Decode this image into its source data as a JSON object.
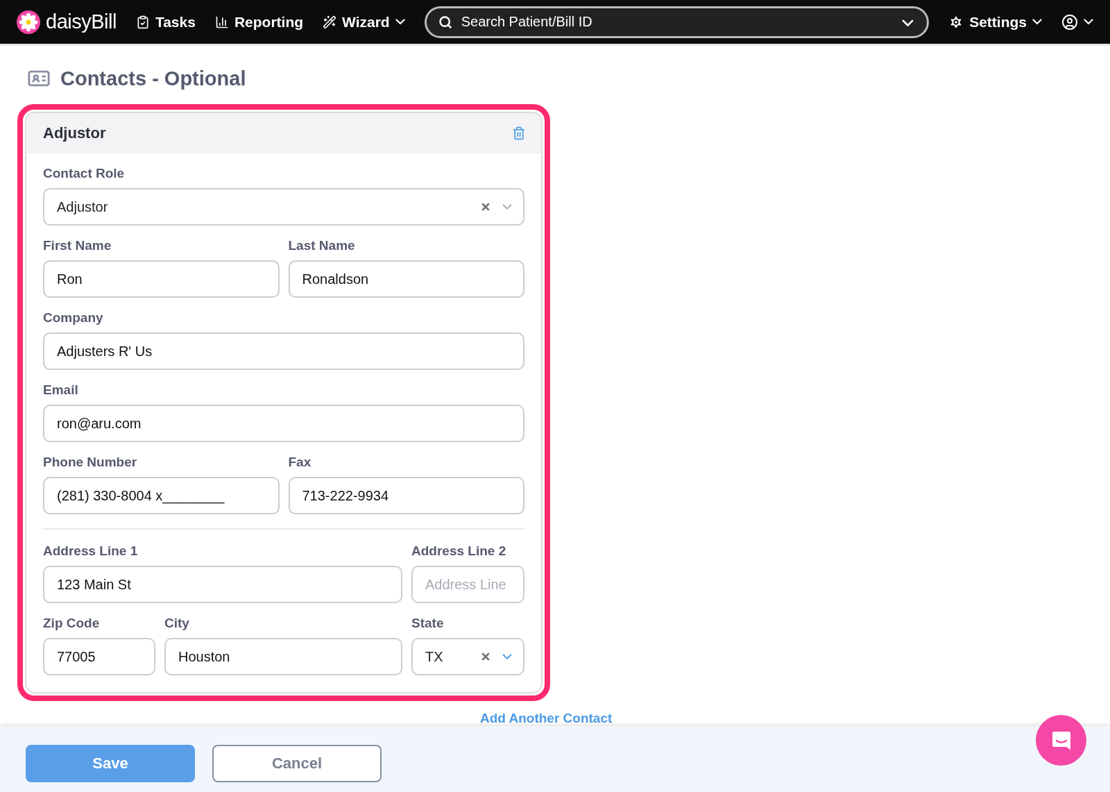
{
  "nav": {
    "logo": "daisyBill",
    "items": [
      {
        "kind": "tasks",
        "label": "Tasks",
        "dropdown": false
      },
      {
        "kind": "reporting",
        "label": "Reporting",
        "dropdown": false
      },
      {
        "kind": "wizard",
        "label": "Wizard",
        "dropdown": true
      }
    ],
    "search": {
      "placeholder": "Search Patient/Bill ID"
    },
    "settings": {
      "label": "Settings"
    }
  },
  "heading": "Contacts - Optional",
  "contact": {
    "title": "Adjustor",
    "rows": [
      {
        "kind": "fields",
        "fields": [
          {
            "kind": "select",
            "label": "Contact Role",
            "value": "Adjustor",
            "clearable": true
          }
        ]
      },
      {
        "kind": "fields",
        "fields": [
          {
            "kind": "text",
            "label": "First Name",
            "value": "Ron"
          },
          {
            "kind": "text",
            "label": "Last Name",
            "value": "Ronaldson"
          }
        ]
      },
      {
        "kind": "fields",
        "fields": [
          {
            "kind": "text",
            "label": "Company",
            "value": "Adjusters R' Us"
          }
        ]
      },
      {
        "kind": "fields",
        "fields": [
          {
            "kind": "text",
            "label": "Email",
            "value": "ron@aru.com"
          }
        ]
      },
      {
        "kind": "fields",
        "fields": [
          {
            "kind": "text",
            "label": "Phone Number",
            "value": "(281) 330-8004 x________"
          },
          {
            "kind": "text",
            "label": "Fax",
            "value": "713-222-9934"
          }
        ]
      },
      {
        "kind": "divider"
      },
      {
        "kind": "fields",
        "fields": [
          {
            "kind": "text",
            "label": "Address Line 1",
            "value": "123 Main St"
          },
          {
            "kind": "text",
            "label": "Address Line 2",
            "placeholder": "Address Line"
          }
        ]
      },
      {
        "kind": "fields",
        "fields": [
          {
            "kind": "text",
            "label": "Zip Code",
            "value": "77005"
          },
          {
            "kind": "text",
            "label": "City",
            "value": "Houston"
          },
          {
            "kind": "select",
            "label": "State",
            "value": "TX",
            "clearable": true
          }
        ]
      }
    ]
  },
  "add_link": "Add Another Contact",
  "buttons": [
    {
      "kind": "primary",
      "label": "Save"
    },
    {
      "kind": "secondary",
      "label": "Cancel"
    }
  ]
}
